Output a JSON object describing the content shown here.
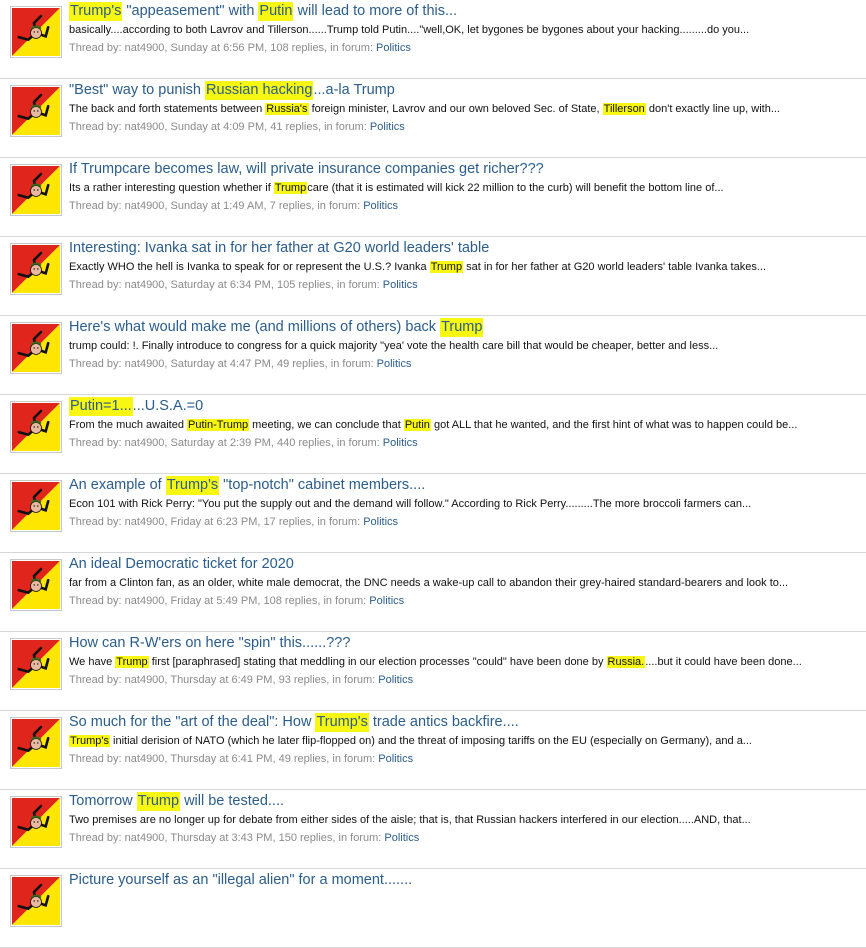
{
  "colors": {
    "highlight": "#f7f713",
    "title_link": "#2b5c8a",
    "meta_text": "#8a8a8a",
    "avatar_red": "#e0261c",
    "avatar_yellow": "#ffe600"
  },
  "meta_labels": {
    "thread_by": "Thread by:",
    "replies_suffix": "replies, in forum:"
  },
  "results": [
    {
      "title": [
        {
          "t": "Trump's",
          "hl": true
        },
        {
          "t": " \"appeasement\" with "
        },
        {
          "t": "Putin",
          "hl": true
        },
        {
          "t": " will lead to more of this..."
        }
      ],
      "snippet": [
        {
          "t": "basically....according to both Lavrov and Tillerson......Trump told Putin....\"well,OK, let bygones be bygones about your hacking.........do you..."
        }
      ],
      "author": "nat4900",
      "date": "Sunday at 6:56 PM",
      "replies": "108",
      "forum": "Politics"
    },
    {
      "title": [
        {
          "t": "\"Best\" way to punish "
        },
        {
          "t": "Russian hacking",
          "hl": true
        },
        {
          "t": "...a-la Trump"
        }
      ],
      "snippet": [
        {
          "t": "The back and forth statements between "
        },
        {
          "t": "Russia's",
          "hl": true
        },
        {
          "t": " foreign minister, Lavrov and our own beloved Sec. of State, "
        },
        {
          "t": "Tillerson",
          "hl": true
        },
        {
          "t": " don't exactly line up, with..."
        }
      ],
      "author": "nat4900",
      "date": "Sunday at 4:09 PM",
      "replies": "41",
      "forum": "Politics"
    },
    {
      "title": [
        {
          "t": "If Trumpcare becomes law, will private insurance companies get richer???"
        }
      ],
      "snippet": [
        {
          "t": "Its a rather interesting question whether if "
        },
        {
          "t": "Trump",
          "hl": true
        },
        {
          "t": "care (that it is estimated will kick 22 million to the curb) will benefit the bottom line of..."
        }
      ],
      "author": "nat4900",
      "date": "Sunday at 1:49 AM",
      "replies": "7",
      "forum": "Politics"
    },
    {
      "title": [
        {
          "t": "Interesting: Ivanka sat in for her father at G20 world leaders' table"
        }
      ],
      "snippet": [
        {
          "t": "Exactly WHO the hell is Ivanka to speak for or represent the U.S.? Ivanka "
        },
        {
          "t": "Trump",
          "hl": true
        },
        {
          "t": " sat in for her father at G20 world leaders' table Ivanka takes..."
        }
      ],
      "author": "nat4900",
      "date": "Saturday at 6:34 PM",
      "replies": "105",
      "forum": "Politics"
    },
    {
      "title": [
        {
          "t": "Here's what would make me (and millions of others) back "
        },
        {
          "t": "Trump",
          "hl": true
        }
      ],
      "snippet": [
        {
          "t": "trump could: !. Finally introduce to congress for a quick majority \"yea' vote the health care bill that would be cheaper, better and less..."
        }
      ],
      "author": "nat4900",
      "date": "Saturday at 4:47 PM",
      "replies": "49",
      "forum": "Politics"
    },
    {
      "title": [
        {
          "t": "Putin=1...",
          "hl": true
        },
        {
          "t": "...U.S.A.=0"
        }
      ],
      "snippet": [
        {
          "t": "From the much awaited "
        },
        {
          "t": "Putin-Trump",
          "hl": true
        },
        {
          "t": " meeting, we can conclude that "
        },
        {
          "t": "Putin",
          "hl": true
        },
        {
          "t": " got ALL that he wanted, and the first hint of what was to happen could be..."
        }
      ],
      "author": "nat4900",
      "date": "Saturday at 2:39 PM",
      "replies": "440",
      "forum": "Politics"
    },
    {
      "title": [
        {
          "t": "An example of "
        },
        {
          "t": "Trump's",
          "hl": true
        },
        {
          "t": " \"top-notch\" cabinet members...."
        }
      ],
      "snippet": [
        {
          "t": "Econ 101 with Rick Perry: \"You put the supply out and the demand will follow.\" According to Rick Perry.........The more broccoli farmers can..."
        }
      ],
      "author": "nat4900",
      "date": "Friday at 6:23 PM",
      "replies": "17",
      "forum": "Politics"
    },
    {
      "title": [
        {
          "t": "An ideal Democratic ticket for 2020"
        }
      ],
      "snippet": [
        {
          "t": "far from a Clinton fan, as an older, white male democrat, the DNC needs a wake-up call to abandon their grey-haired standard-bearers and look to..."
        }
      ],
      "author": "nat4900",
      "date": "Friday at 5:49 PM",
      "replies": "108",
      "forum": "Politics"
    },
    {
      "title": [
        {
          "t": "How can R-W'ers on here \"spin\" this......???"
        }
      ],
      "snippet": [
        {
          "t": "We have "
        },
        {
          "t": "Trump",
          "hl": true
        },
        {
          "t": " first [paraphrased] stating that meddling in our election processes \"could\" have been done by "
        },
        {
          "t": "Russia.",
          "hl": true
        },
        {
          "t": "....but it could have been done..."
        }
      ],
      "author": "nat4900",
      "date": "Thursday at 6:49 PM",
      "replies": "93",
      "forum": "Politics"
    },
    {
      "title": [
        {
          "t": "So much for the \"art of the deal\": How "
        },
        {
          "t": "Trump's",
          "hl": true
        },
        {
          "t": " trade antics backfire...."
        }
      ],
      "snippet": [
        {
          "t": "Trump's",
          "hl": true
        },
        {
          "t": " initial derision of NATO (which he later flip-flopped on) and the threat of imposing tariffs on the EU (especially on Germany), and a..."
        }
      ],
      "author": "nat4900",
      "date": "Thursday at 6:41 PM",
      "replies": "49",
      "forum": "Politics"
    },
    {
      "title": [
        {
          "t": "Tomorrow "
        },
        {
          "t": "Trump",
          "hl": true
        },
        {
          "t": " will be tested...."
        }
      ],
      "snippet": [
        {
          "t": "Two premises are no longer up for debate from either sides of the aisle; that is, that Russian hackers interfered in our election.....AND, that..."
        }
      ],
      "author": "nat4900",
      "date": "Thursday at 3:43 PM",
      "replies": "150",
      "forum": "Politics"
    },
    {
      "title": [
        {
          "t": "Picture yourself as an \"illegal alien\" for a moment......."
        }
      ],
      "snippet": [],
      "author": "",
      "date": "",
      "replies": "",
      "forum": ""
    }
  ]
}
